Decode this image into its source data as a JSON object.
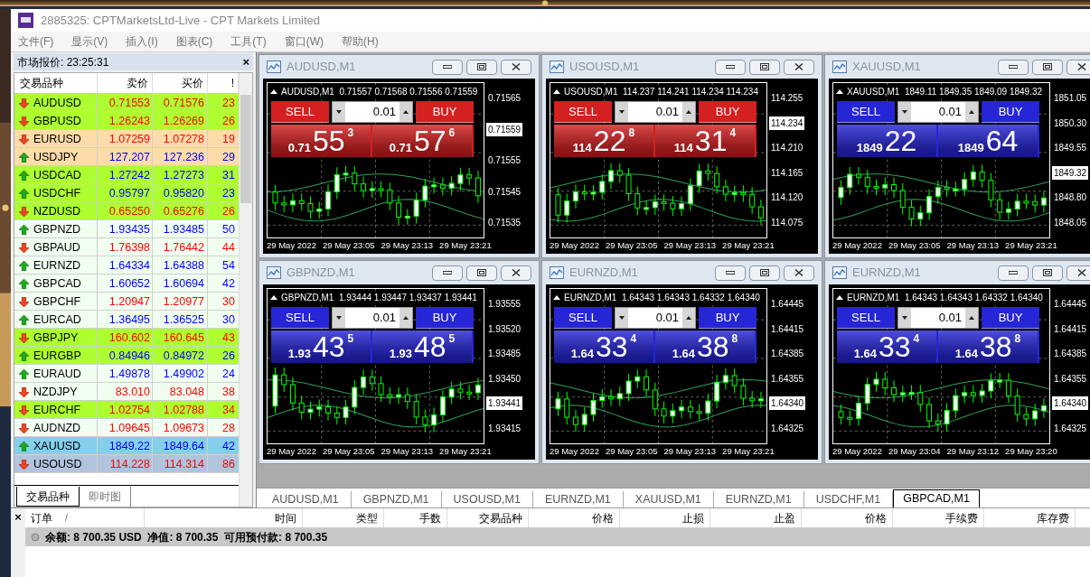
{
  "window": {
    "title": "2885325: CPTMarketsLtd-Live - CPT Markets Limited"
  },
  "menu": [
    "文件(F)",
    "显示(V)",
    "插入(I)",
    "图表(C)",
    "工具(T)",
    "窗口(W)",
    "帮助(H)"
  ],
  "market_watch": {
    "title": "市场报价: 23:25:31",
    "close": "×",
    "columns": [
      "交易品种",
      "卖价",
      "买价",
      "!"
    ],
    "rows": [
      {
        "symbol": "AUDUSD",
        "bid": "0.71553",
        "ask": "0.71576",
        "spread": "23",
        "kind": "down",
        "color": "#adff2f"
      },
      {
        "symbol": "GBPUSD",
        "bid": "1.26243",
        "ask": "1.26269",
        "spread": "26",
        "kind": "down",
        "color": "#adff2f"
      },
      {
        "symbol": "EURUSD",
        "bid": "1.07259",
        "ask": "1.07278",
        "spread": "19",
        "kind": "down",
        "color": "#ffdcaa"
      },
      {
        "symbol": "USDJPY",
        "bid": "127.207",
        "ask": "127.236",
        "spread": "29",
        "kind": "up",
        "color": "#ffdcaa"
      },
      {
        "symbol": "USDCAD",
        "bid": "1.27242",
        "ask": "1.27273",
        "spread": "31",
        "kind": "up",
        "color": "#adff2f"
      },
      {
        "symbol": "USDCHF",
        "bid": "0.95797",
        "ask": "0.95820",
        "spread": "23",
        "kind": "up",
        "color": "#adff2f"
      },
      {
        "symbol": "NZDUSD",
        "bid": "0.65250",
        "ask": "0.65276",
        "spread": "26",
        "kind": "down",
        "color": "#adff2f"
      },
      {
        "symbol": "GBPNZD",
        "bid": "1.93435",
        "ask": "1.93485",
        "spread": "50",
        "kind": "up",
        "color": "#f0fff0"
      },
      {
        "symbol": "GBPAUD",
        "bid": "1.76398",
        "ask": "1.76442",
        "spread": "44",
        "kind": "down",
        "color": "#f0fff0"
      },
      {
        "symbol": "EURNZD",
        "bid": "1.64334",
        "ask": "1.64388",
        "spread": "54",
        "kind": "up",
        "color": "#f0fff0"
      },
      {
        "symbol": "GBPCAD",
        "bid": "1.60652",
        "ask": "1.60694",
        "spread": "42",
        "kind": "up",
        "color": "#f0fff0"
      },
      {
        "symbol": "GBPCHF",
        "bid": "1.20947",
        "ask": "1.20977",
        "spread": "30",
        "kind": "down",
        "color": "#f0fff0"
      },
      {
        "symbol": "EURCAD",
        "bid": "1.36495",
        "ask": "1.36525",
        "spread": "30",
        "kind": "up",
        "color": "#f0fff0"
      },
      {
        "symbol": "GBPJPY",
        "bid": "160.602",
        "ask": "160.645",
        "spread": "43",
        "kind": "down",
        "color": "#adff2f"
      },
      {
        "symbol": "EURGBP",
        "bid": "0.84946",
        "ask": "0.84972",
        "spread": "26",
        "kind": "up",
        "color": "#adff2f"
      },
      {
        "symbol": "EURAUD",
        "bid": "1.49878",
        "ask": "1.49902",
        "spread": "24",
        "kind": "up",
        "color": "#f0fff0"
      },
      {
        "symbol": "NZDJPY",
        "bid": "83.010",
        "ask": "83.048",
        "spread": "38",
        "kind": "down",
        "color": "#f0fff0"
      },
      {
        "symbol": "EURCHF",
        "bid": "1.02754",
        "ask": "1.02788",
        "spread": "34",
        "kind": "down",
        "color": "#adff2f"
      },
      {
        "symbol": "AUDNZD",
        "bid": "1.09645",
        "ask": "1.09673",
        "spread": "28",
        "kind": "down",
        "color": "#f0fff0"
      },
      {
        "symbol": "XAUUSD",
        "bid": "1849.22",
        "ask": "1849.64",
        "spread": "42",
        "kind": "up",
        "color": "#87ceeb"
      },
      {
        "symbol": "USOUSD",
        "bid": "114.228",
        "ask": "114.314",
        "spread": "86",
        "kind": "down",
        "color": "#b0c4de"
      }
    ],
    "tabs": [
      {
        "label": "交易品种",
        "selected": true
      },
      {
        "label": "即时图",
        "selected": false
      }
    ]
  },
  "charts": [
    {
      "title": "AUDUSD,M1",
      "info": "AUDUSD,M1  0.71557 0.71568 0.71556 0.71559",
      "color": "#d42020",
      "sell": {
        "label": "SELL",
        "prefix": "0.71",
        "big": "55",
        "sup": "3"
      },
      "lot": "0.01",
      "buy": {
        "label": "BUY",
        "prefix": "0.71",
        "big": "57",
        "sup": "6"
      },
      "axis": [
        {
          "text": "0.71565",
          "current": false
        },
        {
          "text": "0.71559",
          "current": true
        },
        {
          "text": "0.71555",
          "current": false
        },
        {
          "text": "0.71545",
          "current": false
        },
        {
          "text": "0.71535",
          "current": false
        }
      ],
      "times": [
        "29 May 2022",
        "29 May 23:05",
        "29 May 23:13",
        "29 May 23:21"
      ]
    },
    {
      "title": "USOUSD,M1",
      "info": "USOUSD,M1  114.237 114.241 114.234 114.234",
      "color": "#d42020",
      "sell": {
        "label": "SELL",
        "prefix": "114",
        "big": "22",
        "sup": "8"
      },
      "lot": "0.01",
      "buy": {
        "label": "BUY",
        "prefix": "114",
        "big": "31",
        "sup": "4"
      },
      "axis": [
        {
          "text": "114.255",
          "current": false
        },
        {
          "text": "114.234",
          "current": true
        },
        {
          "text": "114.210",
          "current": false
        },
        {
          "text": "114.165",
          "current": false
        },
        {
          "text": "114.120",
          "current": false
        },
        {
          "text": "114.075",
          "current": false
        }
      ],
      "times": [
        "29 May 2022",
        "29 May 23:05",
        "29 May 23:13",
        "29 May 23:21"
      ]
    },
    {
      "title": "XAUUSD,M1",
      "info": "XAUUSD,M1  1849.11 1849.35 1849.09 1849.32",
      "color": "#2626d6",
      "sell": {
        "label": "SELL",
        "prefix": "1849",
        "big": "22"
      },
      "lot": "0.01",
      "buy": {
        "label": "BUY",
        "prefix": "1849",
        "big": "64"
      },
      "axis": [
        {
          "text": "1851.05",
          "current": false
        },
        {
          "text": "1850.30",
          "current": false
        },
        {
          "text": "1849.55",
          "current": false
        },
        {
          "text": "1849.32",
          "current": true
        },
        {
          "text": "1848.80",
          "current": false
        },
        {
          "text": "1848.05",
          "current": false
        }
      ],
      "times": [
        "29 May 2022",
        "29 May 23:05",
        "29 May 23:13",
        "29 May 23:21"
      ]
    },
    {
      "title": "GBPNZD,M1",
      "info": "GBPNZD,M1  1.93444 1.93447 1.93437 1.93441",
      "color": "#2626d6",
      "sell": {
        "label": "SELL",
        "prefix": "1.93",
        "big": "43",
        "sup": "5"
      },
      "lot": "0.01",
      "buy": {
        "label": "BUY",
        "prefix": "1.93",
        "big": "48",
        "sup": "5"
      },
      "axis": [
        {
          "text": "1.93555",
          "current": false
        },
        {
          "text": "1.93520",
          "current": false
        },
        {
          "text": "1.93485",
          "current": false
        },
        {
          "text": "1.93450",
          "current": false
        },
        {
          "text": "1.93441",
          "current": true
        },
        {
          "text": "1.93415",
          "current": false
        }
      ],
      "times": [
        "29 May 2022",
        "29 May 23:05",
        "29 May 23:13",
        "29 May 23:21"
      ]
    },
    {
      "title": "EURNZD,M1",
      "info": "EURNZD,M1  1.64343 1.64343 1.64332 1.64340",
      "color": "#2626d6",
      "sell": {
        "label": "SELL",
        "prefix": "1.64",
        "big": "33",
        "sup": "4"
      },
      "lot": "0.01",
      "buy": {
        "label": "BUY",
        "prefix": "1.64",
        "big": "38",
        "sup": "8"
      },
      "axis": [
        {
          "text": "1.64445",
          "current": false
        },
        {
          "text": "1.64415",
          "current": false
        },
        {
          "text": "1.64385",
          "current": false
        },
        {
          "text": "1.64355",
          "current": false
        },
        {
          "text": "1.64340",
          "current": true
        },
        {
          "text": "1.64325",
          "current": false
        }
      ],
      "times": [
        "29 May 2022",
        "29 May 23:05",
        "29 May 23:13",
        "29 May 23:21"
      ]
    },
    {
      "title": "EURNZD,M1",
      "info": "EURNZD,M1  1.64343 1.64343 1.64332 1.64340",
      "color": "#2626d6",
      "sell": {
        "label": "SELL",
        "prefix": "1.64",
        "big": "33",
        "sup": "4"
      },
      "lot": "0.01",
      "buy": {
        "label": "BUY",
        "prefix": "1.64",
        "big": "38",
        "sup": "8"
      },
      "axis": [
        {
          "text": "1.64445",
          "current": false
        },
        {
          "text": "1.64415",
          "current": false
        },
        {
          "text": "1.64385",
          "current": false
        },
        {
          "text": "1.64355",
          "current": false
        },
        {
          "text": "1.64340",
          "current": true
        },
        {
          "text": "1.64325",
          "current": false
        }
      ],
      "times": [
        "29 May 2022",
        "29 May 23:04",
        "29 May 23:12",
        "29 May 23:20"
      ]
    }
  ],
  "chart_tabs": [
    {
      "label": "AUDUSD,M1",
      "selected": false
    },
    {
      "label": "GBPNZD,M1",
      "selected": false
    },
    {
      "label": "USOUSD,M1",
      "selected": false
    },
    {
      "label": "EURNZD,M1",
      "selected": false
    },
    {
      "label": "XAUUSD,M1",
      "selected": false
    },
    {
      "label": "EURNZD,M1",
      "selected": false
    },
    {
      "label": "USDCHF,M1",
      "selected": false
    },
    {
      "label": "GBPCAD,M1",
      "selected": true
    }
  ],
  "terminal": {
    "close": "×",
    "columns": [
      "订单",
      "时间",
      "类型",
      "手数",
      "交易品种",
      "价格",
      "止损",
      "止盈",
      "价格",
      "手续费",
      "库存费"
    ],
    "sort_mark": "/",
    "balance": "余额: 8 700.35 USD  净值: 8 700.35  可用预付款: 8 700.35"
  }
}
